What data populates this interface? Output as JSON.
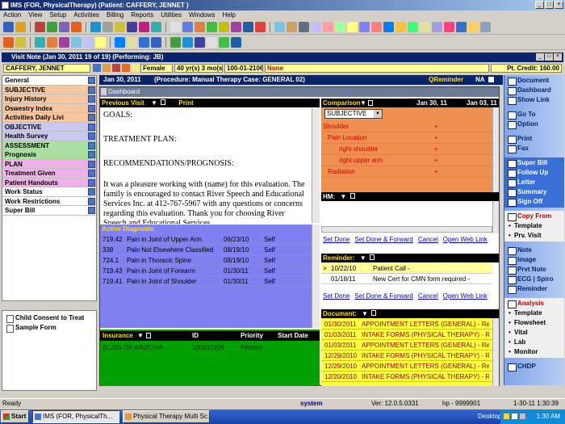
{
  "window": {
    "title": "IMS (FOR, PhysicalTherapy)   (Patient: CAFFERY, JENNET )"
  },
  "menu": [
    "Action",
    "View",
    "Setup",
    "Activities",
    "Billing",
    "Reports",
    "Utilities",
    "Windows",
    "Help"
  ],
  "visitnote": {
    "title": "Visit Note (Jan 30, 2011   19 of 19) (Performing: JB)"
  },
  "patient": {
    "name": "CAFFERY, JENNET",
    "sex": "Female",
    "age": "40 yr(s) 3 mo(s)",
    "id": "100-01-2106",
    "flag": "None",
    "credit": "Pt. Credit: 160.00"
  },
  "visit_header": {
    "date": "Jan 30, 2011",
    "procedure": "(Procedure:  Manual Therapy  Case: GENERAL 02)",
    "qreminder": "QReminder",
    "na": "NA"
  },
  "leftnav": [
    {
      "label": "General",
      "color": "#ffffff"
    },
    {
      "label": "SUBJECTIVE",
      "color": "#f7c8a0"
    },
    {
      "label": "Injury History",
      "color": "#f7c8a0"
    },
    {
      "label": "Oswestry Index",
      "color": "#f7c8a0"
    },
    {
      "label": "Activities Daily Livi",
      "color": "#f7c8a0"
    },
    {
      "label": "OBJECTIVE",
      "color": "#c8c8f0"
    },
    {
      "label": "Health Survey",
      "color": "#c8c8f0"
    },
    {
      "label": "ASSESSMENT",
      "color": "#a8e0a0"
    },
    {
      "label": "Prognosis",
      "color": "#a8e0a0"
    },
    {
      "label": "PLAN",
      "color": "#f0b0e8"
    },
    {
      "label": "Treatment Given",
      "color": "#f0b0e8"
    },
    {
      "label": "Patient Handouts",
      "color": "#f0b0e8"
    },
    {
      "label": "Work Status",
      "color": "#ffffff"
    },
    {
      "label": "Work Restrictions",
      "color": "#ffffff"
    },
    {
      "label": "Super Bill",
      "color": "#ffffff"
    }
  ],
  "forms": [
    "Child Consent to Treat",
    "Sample Form"
  ],
  "dashboard": {
    "title": "Dashboard",
    "previous_visit": "Previous Visit",
    "print": "Print",
    "doc_lines": [
      "GOALS:",
      "TREATMENT PLAN:",
      "RECOMMENDATIONS/PROGNOSIS:"
    ],
    "doc_paragraph": "It was a pleasure working with (name) for this evaluation. The family is encouraged to contact River Speech and Educational Services Inc. at 412-767-5967 with any questions or concerns regarding this evaluation.  Thank you for choosing River Speech and Educational Services",
    "active_dx_label": "Active Diagnosis:",
    "diagnoses": [
      {
        "code": "719.42",
        "desc": "Pain in Joint of Upper Arm",
        "date": "06/23/10",
        "by": "Self"
      },
      {
        "code": "338",
        "desc": "Pain Not Elsewhere Classified",
        "date": "08/19/10",
        "by": "Self"
      },
      {
        "code": "724.1",
        "desc": "Pain in Thoracic Spine",
        "date": "08/19/10",
        "by": "Self"
      },
      {
        "code": "719.43",
        "desc": "Pain in Joint of Forearm",
        "date": "01/30/11",
        "by": "Self"
      },
      {
        "code": "719.41",
        "desc": "Pain in Joint of Shoulder",
        "date": "01/30/11",
        "by": "Self"
      }
    ],
    "insurance": {
      "label": "Insurance",
      "col_id": "ID",
      "col_priority": "Priority",
      "col_start": "Start Date",
      "name": "BC/BS OF ARIZONA",
      "id": "100012106",
      "priority": "Primary"
    },
    "comparison": {
      "label": "Comparison",
      "col1": "Jan 30, 11",
      "col2": "Jan 03, 11",
      "select": "SUBJECTIVE",
      "rows": [
        {
          "label": "Shoulder",
          "v1": "+"
        },
        {
          "label": "Pain Location",
          "v1": "+"
        },
        {
          "label": "right shoulder",
          "v1": "+"
        },
        {
          "label": "right upper arm",
          "v1": "+"
        },
        {
          "label": "Radiation",
          "v1": "+"
        }
      ]
    },
    "hm_label": "HM:",
    "links": {
      "set_done": "Set Done",
      "set_done_forward": "Set Done & Forward",
      "cancel": "Cancel",
      "open_web": "Open Web Link"
    },
    "reminder_label": "Reminder:",
    "reminders": [
      {
        "date": "10/22/10",
        "text": "Patient Call  -"
      },
      {
        "date": "01/18/11",
        "text": "New Cert for CMN form required  -"
      }
    ],
    "document_label": "Document:",
    "documents": [
      {
        "date": "01/30/2011",
        "text": "APPOINTMENT LETTERS (GENERAL) - Referral"
      },
      {
        "date": "01/03/2011",
        "text": "INTAKE FORMS (PHYSICAL THERAPY) - Referral"
      },
      {
        "date": "01/03/2011",
        "text": "APPOINTMENT LETTERS (GENERAL) - Referral"
      },
      {
        "date": "12/29/2010",
        "text": "INTAKE FORMS (PHYSICAL THERAPY) - Referral"
      },
      {
        "date": "12/29/2010",
        "text": "APPOINTMENT LETTERS (GENERAL) - Referral"
      },
      {
        "date": "12/20/2010",
        "text": "INTAKE FORMS (PHYSICAL THERAPY) - Referral"
      }
    ]
  },
  "rightnav": {
    "g1": [
      "Document",
      "Dashboard",
      "Show Link"
    ],
    "g2": [
      "Go To",
      "Option"
    ],
    "g3": [
      "Print",
      "Fax"
    ],
    "g4": [
      "Super Bill",
      "Follow Up",
      "Letter",
      "Summary",
      "Sign Off"
    ],
    "copyfrom": "Copy From",
    "copy_items": [
      "Template",
      "Prv. Visit"
    ],
    "g5": [
      "Note",
      "Image",
      "Prvt Note",
      "ECG | Spiro",
      "Reminder"
    ],
    "analysis": "Analysis",
    "analysis_items": [
      "Template",
      "Flowsheet",
      "Vital",
      "Lab",
      "Monitor"
    ],
    "chdp": "CHDP"
  },
  "status": {
    "ready": "Ready",
    "system": "system",
    "version": "Ver: 12.0.5.0331",
    "hp": "hp - 9999901",
    "datetime": "1-30-11  1:30:39"
  },
  "taskbar": {
    "start": "Start",
    "items": [
      "IMS (FOR, PhysicalTh...",
      "Physical Therapy Multi Sc..."
    ],
    "desktop": "Desktop",
    "time": "1:30 AM"
  }
}
